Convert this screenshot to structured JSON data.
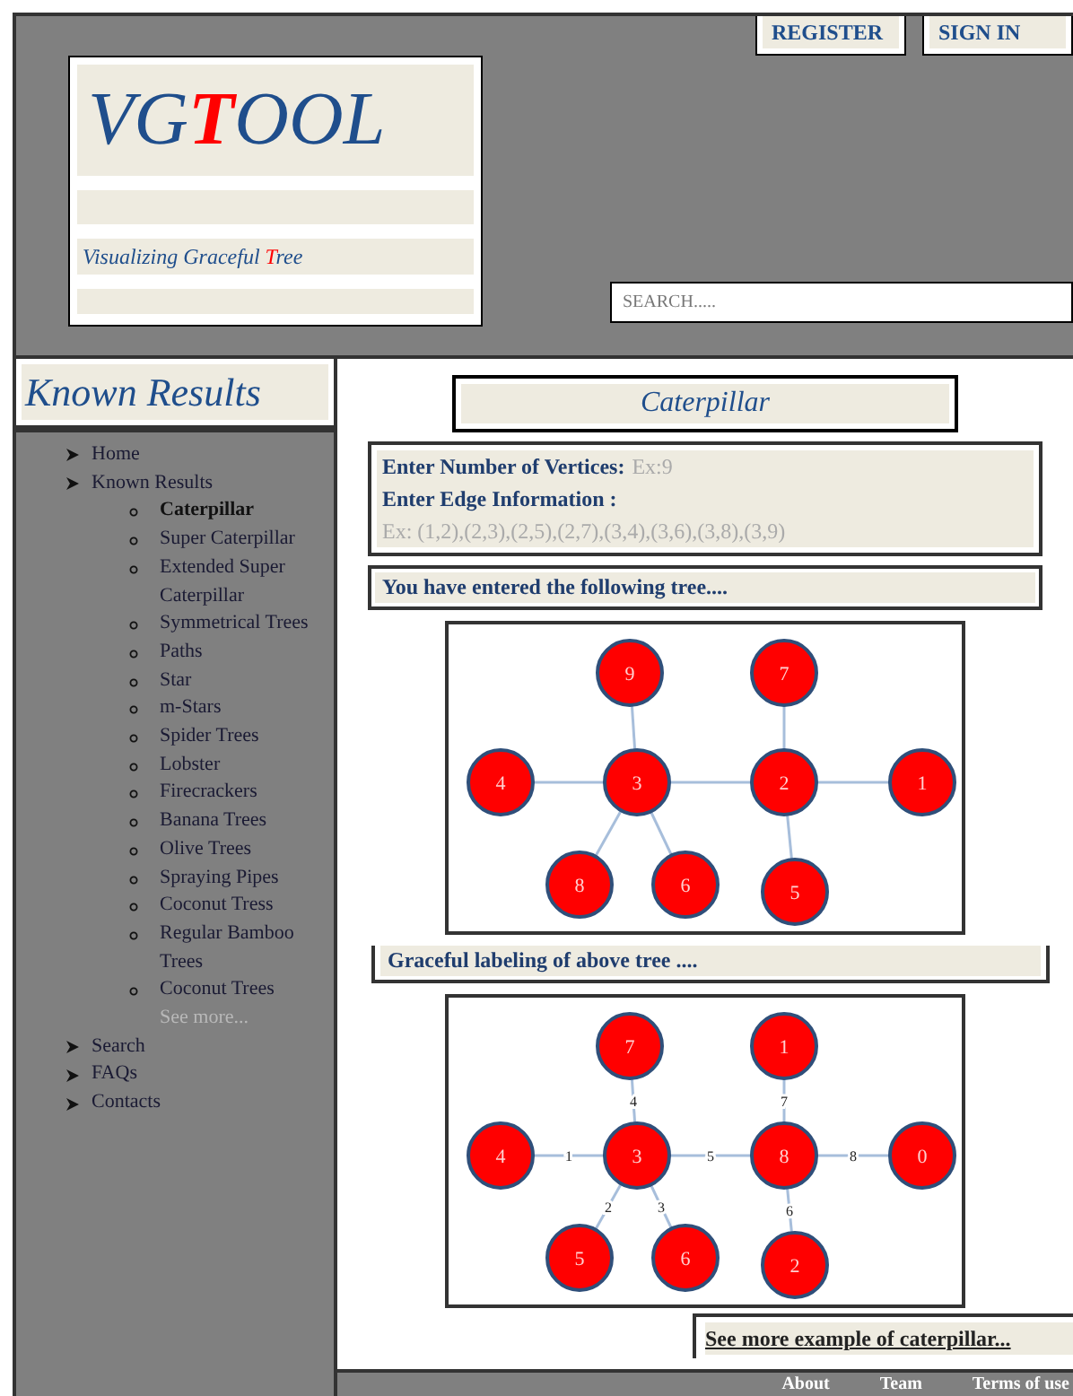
{
  "header": {
    "logo": {
      "parts": [
        {
          "text": "VG",
          "highlight": false
        },
        {
          "text": "T",
          "highlight": true
        },
        {
          "text": "OOL",
          "highlight": false
        }
      ]
    },
    "tagline": {
      "parts": [
        {
          "text": "Visualizing Graceful ",
          "highlight": false
        },
        {
          "text": "T",
          "highlight": true
        },
        {
          "text": "ree",
          "highlight": false
        }
      ]
    },
    "buttons": [
      "REGISTER",
      "SIGN IN"
    ],
    "search": {
      "placeholder": "SEARCH....."
    }
  },
  "sidebar": {
    "title": "Known Results",
    "items": [
      {
        "label": "Home"
      },
      {
        "label": "Known Results",
        "children": [
          {
            "label": "Caterpillar",
            "selected": true
          },
          {
            "label": "Super Caterpillar",
            "selected": false
          },
          {
            "label": "Extended Super Caterpillar",
            "selected": false
          },
          {
            "label": "Symmetrical Trees",
            "selected": false
          },
          {
            "label": "Paths",
            "selected": false
          },
          {
            "label": "Star",
            "selected": false
          },
          {
            "label": "m-Stars",
            "selected": false
          },
          {
            "label": "Spider Trees",
            "selected": false
          },
          {
            "label": "Lobster",
            "selected": false
          },
          {
            "label": "Firecrackers",
            "selected": false
          },
          {
            "label": "Banana Trees",
            "selected": false
          },
          {
            "label": "Olive Trees",
            "selected": false
          },
          {
            "label": "Spraying Pipes",
            "selected": false
          },
          {
            "label": "Coconut Tress",
            "selected": false
          },
          {
            "label": "Regular  Bamboo Trees",
            "selected": false
          },
          {
            "label": "Coconut Trees",
            "selected": false
          }
        ],
        "see_more": "See more..."
      },
      {
        "label": "Search"
      },
      {
        "label": "FAQs"
      },
      {
        "label": "Contacts"
      }
    ]
  },
  "main": {
    "title": "Caterpillar",
    "input": {
      "vertices_label": "Enter Number of Vertices:",
      "vertices_placeholder": "Ex:9",
      "edges_label": "Enter Edge Information :",
      "edges_placeholder": "Ex: (1,2),(2,3),(2,5),(2,7),(3,4),(3,6),(3,8),(3,9)"
    },
    "entered_heading": "You have entered the following tree....",
    "entered_tree": {
      "nodes": [
        "9",
        "7",
        "4",
        "3",
        "2",
        "1",
        "8",
        "6",
        "5"
      ]
    },
    "graceful_heading": "Graceful labeling of above tree ....",
    "graceful_tree": {
      "nodes": [
        "7",
        "1",
        "4",
        "3",
        "8",
        "0",
        "5",
        "6",
        "2"
      ],
      "edge_labels": [
        "4",
        "7",
        "1",
        "5",
        "8",
        "2",
        "3",
        "6"
      ]
    },
    "see_more_link": "See more example of caterpillar..."
  },
  "footer": {
    "links": [
      "About",
      "Team",
      "Terms of use"
    ]
  }
}
